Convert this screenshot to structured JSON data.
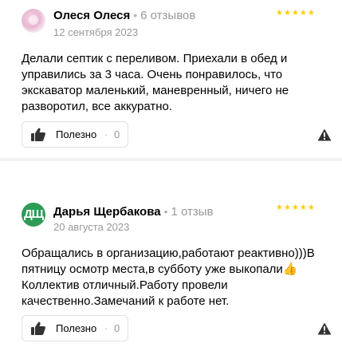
{
  "reviews": [
    {
      "author": "Олеся Олеся",
      "reviews_count": "6 отзывов",
      "date": "12 сентября 2023",
      "rating": 5,
      "stars": "★★★★★",
      "text": "Делали септик с переливом. Приехали в обед и управились за 3 часа. Очень понравилось, что экскаватор маленький, маневренный, ничего не разворотил, все аккуратно.",
      "helpful_label": "Полезно",
      "helpful_count": "0"
    },
    {
      "author": "Дарья Щербакова",
      "avatar_initials": "ДЩ",
      "reviews_count": "1 отзыв",
      "date": "20 августа 2023",
      "rating": 5,
      "stars": "★★★★★",
      "text": "Обращались в организацию,работают реактивно)))В пятницу осмотр места,в субботу уже выкопали👍Коллектив отличный.Работу провели качественно.Замечаний к работе нет.",
      "helpful_label": "Полезно",
      "helpful_count": "0"
    }
  ],
  "colors": {
    "star": "#ffcc00",
    "avatar_green": "#2e9b57",
    "muted_text": "#999999"
  },
  "icons": [
    "thumbs-up-icon",
    "warning-triangle-icon"
  ]
}
